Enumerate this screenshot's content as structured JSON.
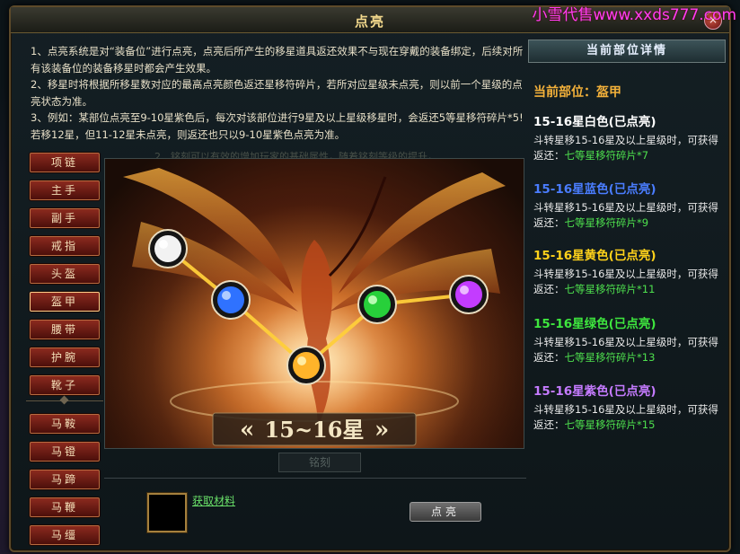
{
  "window": {
    "title": "点亮",
    "watermark": "小雪代售www.xxds777.com",
    "close_label": "×"
  },
  "description": [
    "1、点亮系统是对“装备位”进行点亮，点亮后所产生的移星道具返还效果不与现在穿戴的装备绑定，后续对所有该装备位的装备移星时都会产生效果。",
    "2、移星时将根据所移星数对应的最高点亮颜色返还星移符碎片，若所对应星级未点亮，则以前一个星级的点亮状态为准。",
    "3、例如：某部位点亮至9-10星紫色后，每次对该部位进行9星及以上星级移星时，会返还5等星移符碎片*5!若移12星，但11-12星未点亮，则返还也只以9-10星紫色点亮为准。"
  ],
  "ghost_text": "2、铭刻可以有效的增加玩家的基础属性，随着铭刻等级的提升，",
  "slots": [
    "项链",
    "主手",
    "副手",
    "戒指",
    "头盔",
    "盔甲",
    "腰带",
    "护腕",
    "靴子",
    "马鞍",
    "马镫",
    "马蹄",
    "马鞭",
    "马缰"
  ],
  "star_banner": "15~16星",
  "orbs": [
    {
      "color": "white",
      "hex": "#f2f2f2"
    },
    {
      "color": "blue",
      "hex": "#2f72ff"
    },
    {
      "color": "yellow",
      "hex": "#ffb42a"
    },
    {
      "color": "green",
      "hex": "#27d03a"
    },
    {
      "color": "purple",
      "hex": "#c33cff"
    }
  ],
  "inlay_label": "铭刻",
  "bottom": {
    "material_link": "获取材料",
    "light_button": "点亮"
  },
  "right_panel": {
    "header": "当前部位详情",
    "current_part": "当前部位：盔甲",
    "entries": [
      {
        "title": "15-16星白色(已点亮)",
        "color": "#ffffff",
        "desc": "斗转星移15-16星及以上星级时，可获得返还：",
        "reward": "七等星移符碎片*7"
      },
      {
        "title": "15-16星蓝色(已点亮)",
        "color": "#4a7dff",
        "desc": "斗转星移15-16星及以上星级时，可获得返还：",
        "reward": "七等星移符碎片*9"
      },
      {
        "title": "15-16星黄色(已点亮)",
        "color": "#ffd21a",
        "desc": "斗转星移15-16星及以上星级时，可获得返还：",
        "reward": "七等星移符碎片*11"
      },
      {
        "title": "15-16星绿色(已点亮)",
        "color": "#3ee63e",
        "desc": "斗转星移15-16星及以上星级时，可获得返还：",
        "reward": "七等星移符碎片*13"
      },
      {
        "title": "15-16星紫色(已点亮)",
        "color": "#c57bff",
        "desc": "斗转星移15-16星及以上星级时，可获得返还：",
        "reward": "七等星移符碎片*15"
      }
    ]
  }
}
